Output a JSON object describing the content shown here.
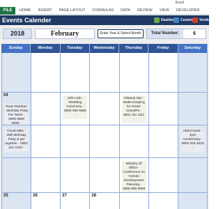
{
  "window": {
    "title": "Excel"
  },
  "ribbon": {
    "file_tab": "FILE",
    "tabs": [
      "HOME",
      "INSERT",
      "PAGE LAYOUT",
      "FORMULAS",
      "DATA",
      "REVIEW",
      "VIEW",
      "DEVELOPER"
    ]
  },
  "app": {
    "title": "Events Calender",
    "buttons": {
      "dashboard": "Dashboard",
      "customer": "Customer",
      "vendor": "Vendor"
    }
  },
  "controls": {
    "year": "2018",
    "month": "February",
    "enter_button": "Enter Year & Select Month",
    "total_label": "Total Number:",
    "total_value": "6"
  },
  "calendar": {
    "days": [
      "Sunday",
      "Monday",
      "Tuesday",
      "Wednesday",
      "Thursday",
      "Friday",
      "Saturday"
    ],
    "weeks": [
      [
        {
          "d": "",
          "e": ""
        },
        {
          "d": "",
          "e": ""
        },
        {
          "d": "",
          "e": ""
        },
        {
          "d": "",
          "e": ""
        },
        {
          "d": "",
          "e": ""
        },
        {
          "d": "",
          "e": ""
        },
        {
          "d": "",
          "e": ""
        }
      ],
      [
        {
          "d": "04",
          "e": "Rose Random - Birthday Party For Twins - 0909 9999 9999 -"
        },
        {
          "d": "",
          "e": ""
        },
        {
          "d": "",
          "e": "John Ade - Wedding Ceremony - 0808 666 6666 -"
        },
        {
          "d": "",
          "e": ""
        },
        {
          "d": "",
          "e": "Olatunji Niyi - Wake Keeping for Great-GrandPa - 0801 111 1111 -"
        },
        {
          "d": "",
          "e": ""
        },
        {
          "d": "",
          "e": ""
        }
      ],
      [
        {
          "d": "",
          "e": "Chudi Mike - 35th Birthday Party & get together - 0802 222 2222 -"
        },
        {
          "d": "",
          "e": ""
        },
        {
          "d": "",
          "e": ""
        },
        {
          "d": "",
          "e": ""
        },
        {
          "d": "",
          "e": ""
        },
        {
          "d": "",
          "e": ""
        },
        {
          "d": "",
          "e": "Abdul Nasir - 3yrs Anniversary - 0803 333 3333 -"
        }
      ],
      [
        {
          "d": "",
          "e": ""
        },
        {
          "d": "",
          "e": ""
        },
        {
          "d": "",
          "e": ""
        },
        {
          "d": "",
          "e": ""
        },
        {
          "d": "",
          "e": "Ministry Of Office - Conference on Human Development Planning - 0809 999 9999 -"
        },
        {
          "d": "",
          "e": ""
        },
        {
          "d": "",
          "e": ""
        }
      ],
      [
        {
          "d": "25",
          "e": ""
        },
        {
          "d": "26",
          "e": ""
        },
        {
          "d": "27",
          "e": ""
        },
        {
          "d": "28",
          "e": ""
        },
        {
          "d": "",
          "e": ""
        },
        {
          "d": "",
          "e": ""
        },
        {
          "d": "",
          "e": ""
        }
      ]
    ]
  }
}
